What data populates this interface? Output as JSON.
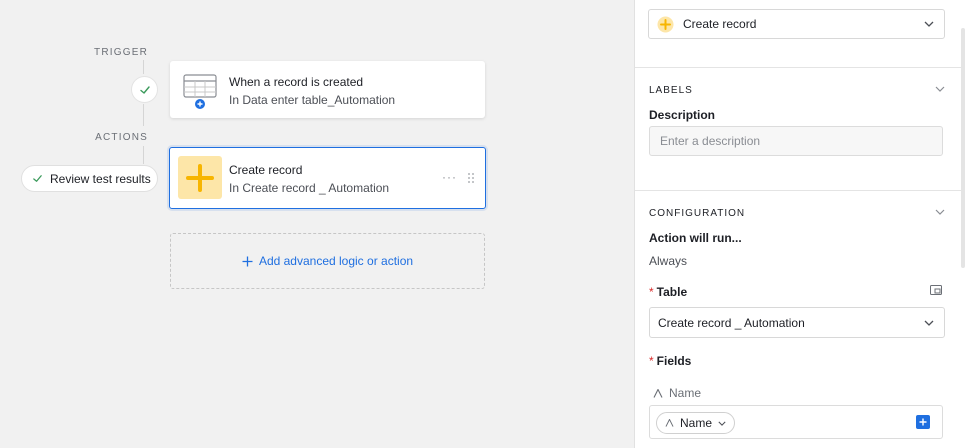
{
  "canvas": {
    "trigger_label": "TRIGGER",
    "actions_label": "ACTIONS",
    "trigger_card": {
      "title": "When a record is created",
      "subtitle": "In Data enter table_Automation",
      "icon": "table-plus-icon"
    },
    "action_card": {
      "title": "Create record",
      "subtitle": "In Create record _ Automation",
      "icon": "plus-icon",
      "menu_icon": "more-dots-icon",
      "drag_icon": "drag-handle-icon"
    },
    "review_button": {
      "label": "Review test results",
      "icon": "check-icon"
    },
    "add_action": {
      "label": "Add advanced logic or action",
      "icon": "plus-icon"
    }
  },
  "panel": {
    "action_type": {
      "value": "Create record",
      "icon": "plus-circle-icon"
    },
    "labels_section": {
      "title": "LABELS",
      "description_label": "Description",
      "description_placeholder": "Enter a description"
    },
    "configuration_section": {
      "title": "CONFIGURATION",
      "runs_label": "Action will run...",
      "runs_value": "Always",
      "table_label": "Table",
      "table_value": "Create record _ Automation",
      "fields_label": "Fields",
      "field_name_label": "Name",
      "field_chip_label": "Name"
    }
  },
  "colors": {
    "accent": "#1f6fe0",
    "action_icon_bg": "#fde6a8",
    "action_icon_fg": "#f7b500",
    "required": "#d92b2b"
  }
}
